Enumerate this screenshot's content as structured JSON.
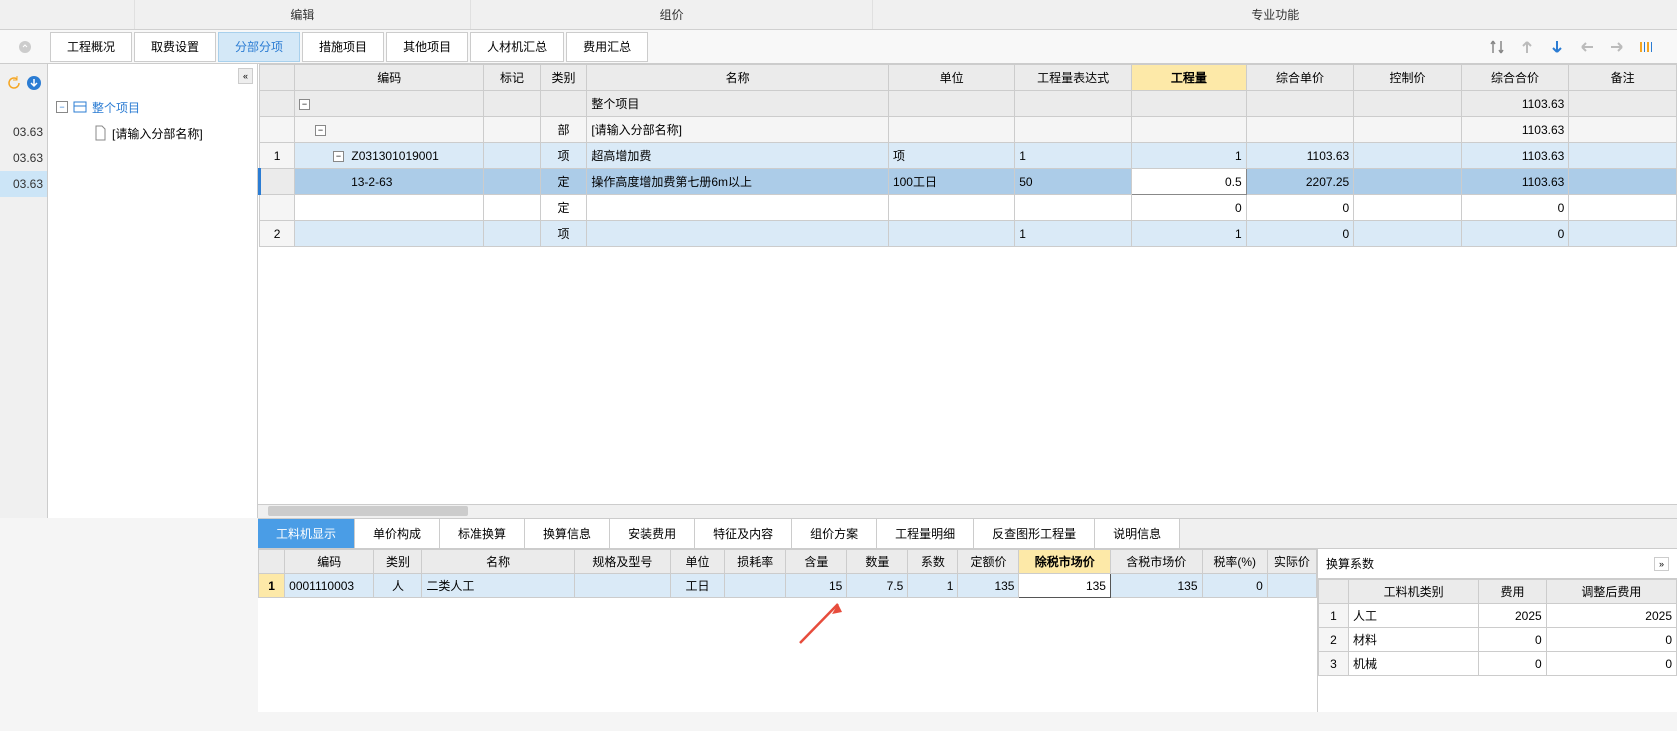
{
  "topMenu": {
    "item1": "编辑",
    "item2": "组价",
    "item3": "专业功能"
  },
  "tabs": {
    "t1": "工程概况",
    "t2": "取费设置",
    "t3": "分部分项",
    "t4": "措施项目",
    "t5": "其他项目",
    "t6": "人材机汇总",
    "t7": "费用汇总"
  },
  "gutterValues": {
    "v1": "03.63",
    "v2": "03.63",
    "v3": "03.63"
  },
  "tree": {
    "root": "整个项目",
    "child": "[请输入分部名称]"
  },
  "mainHeaders": {
    "h0": "",
    "h1": "编码",
    "h2": "标记",
    "h3": "类别",
    "h4": "名称",
    "h5": "单位",
    "h6": "工程量表达式",
    "h7": "工程量",
    "h8": "综合单价",
    "h9": "控制价",
    "h10": "综合合价",
    "h11": "备注"
  },
  "mainRows": {
    "r0": {
      "name": "整个项目",
      "total": "1103.63"
    },
    "r1": {
      "type": "部",
      "name": "[请输入分部名称]",
      "total": "1103.63"
    },
    "r2": {
      "num": "1",
      "code": "Z031301019001",
      "type": "项",
      "name": "超高增加费",
      "unit": "项",
      "expr": "1",
      "qty": "1",
      "price": "1103.63",
      "total": "1103.63"
    },
    "r3": {
      "code": "13-2-63",
      "type": "定",
      "name": "操作高度增加费第七册6m以上",
      "unit": "100工日",
      "expr": "50",
      "qty": "0.5",
      "price": "2207.25",
      "total": "1103.63"
    },
    "r4": {
      "type": "定",
      "qty": "0",
      "price": "0",
      "total": "0"
    },
    "r5": {
      "num": "2",
      "type": "项",
      "expr": "1",
      "qty": "1",
      "price": "0",
      "total": "0"
    }
  },
  "bottomTabs": {
    "t1": "工料机显示",
    "t2": "单价构成",
    "t3": "标准换算",
    "t4": "换算信息",
    "t5": "安装费用",
    "t6": "特征及内容",
    "t7": "组价方案",
    "t8": "工程量明细",
    "t9": "反查图形工程量",
    "t10": "说明信息"
  },
  "detailHeaders": {
    "h0": "",
    "h1": "编码",
    "h2": "类别",
    "h3": "名称",
    "h4": "规格及型号",
    "h5": "单位",
    "h6": "损耗率",
    "h7": "含量",
    "h8": "数量",
    "h9": "系数",
    "h10": "定额价",
    "h11": "除税市场价",
    "h12": "含税市场价",
    "h13": "税率(%)",
    "h14": "实际价"
  },
  "detailRow": {
    "num": "1",
    "code": "0001110003",
    "cat": "人",
    "name": "二类人工",
    "unit": "工日",
    "content": "15",
    "qty": "7.5",
    "factor": "1",
    "dprice": "135",
    "mprice": "135",
    "tprice": "135",
    "tax": "0"
  },
  "sidePanel": {
    "title": "换算系数",
    "h1": "工料机类别",
    "h2": "费用",
    "h3": "调整后费用",
    "rows": {
      "r1": {
        "n": "1",
        "cat": "人工",
        "cost": "2025",
        "adj": "2025"
      },
      "r2": {
        "n": "2",
        "cat": "材料",
        "cost": "0",
        "adj": "0"
      },
      "r3": {
        "n": "3",
        "cat": "机械",
        "cost": "0",
        "adj": "0"
      }
    }
  }
}
